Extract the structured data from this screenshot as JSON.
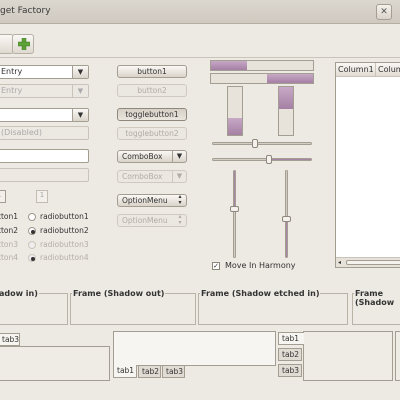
{
  "window": {
    "title": "get Factory",
    "close_glyph": "✕"
  },
  "toolbar": {
    "icons": [
      "blank-icon",
      "add-icon"
    ]
  },
  "col1": {
    "combo_entry": "Entry",
    "combo_entry_disabled": "Entry",
    "combo_disabled": "(Disabled)",
    "spin_value": "1",
    "radios_a": [
      "tton1",
      "tton2",
      "tton3",
      "tton4"
    ]
  },
  "col2": {
    "button1": "button1",
    "button2": "button2",
    "toggle1": "togglebutton1",
    "toggle2": "togglebutton2",
    "combobox1": "ComboBox",
    "combobox2": "ComboBox",
    "optionmenu1": "OptionMenu",
    "optionmenu2": "OptionMenu",
    "radios_b": [
      "radiobutton1",
      "radiobutton2",
      "radiobutton3",
      "radiobutton4"
    ]
  },
  "col3": {
    "checkbox_label": "Move In Harmony",
    "progress_fractions": [
      0.35,
      0.55
    ],
    "vprogress_fractions": [
      0.35,
      0.55
    ]
  },
  "treeview": {
    "columns": [
      "Column1",
      "Column"
    ]
  },
  "frames": [
    "adow in)",
    "Frame (Shadow out)",
    "Frame (Shadow etched in)",
    "Frame (Shadow"
  ],
  "notebooks": {
    "nb1_tabs": [
      "tab3"
    ],
    "nb2_tabs": [
      "tab1",
      "tab2",
      "tab3"
    ],
    "nb3_tabs": [
      "tab1",
      "tab2",
      "tab3"
    ]
  },
  "colors": {
    "accent": "#a884a6",
    "background": "#ede9e3"
  }
}
